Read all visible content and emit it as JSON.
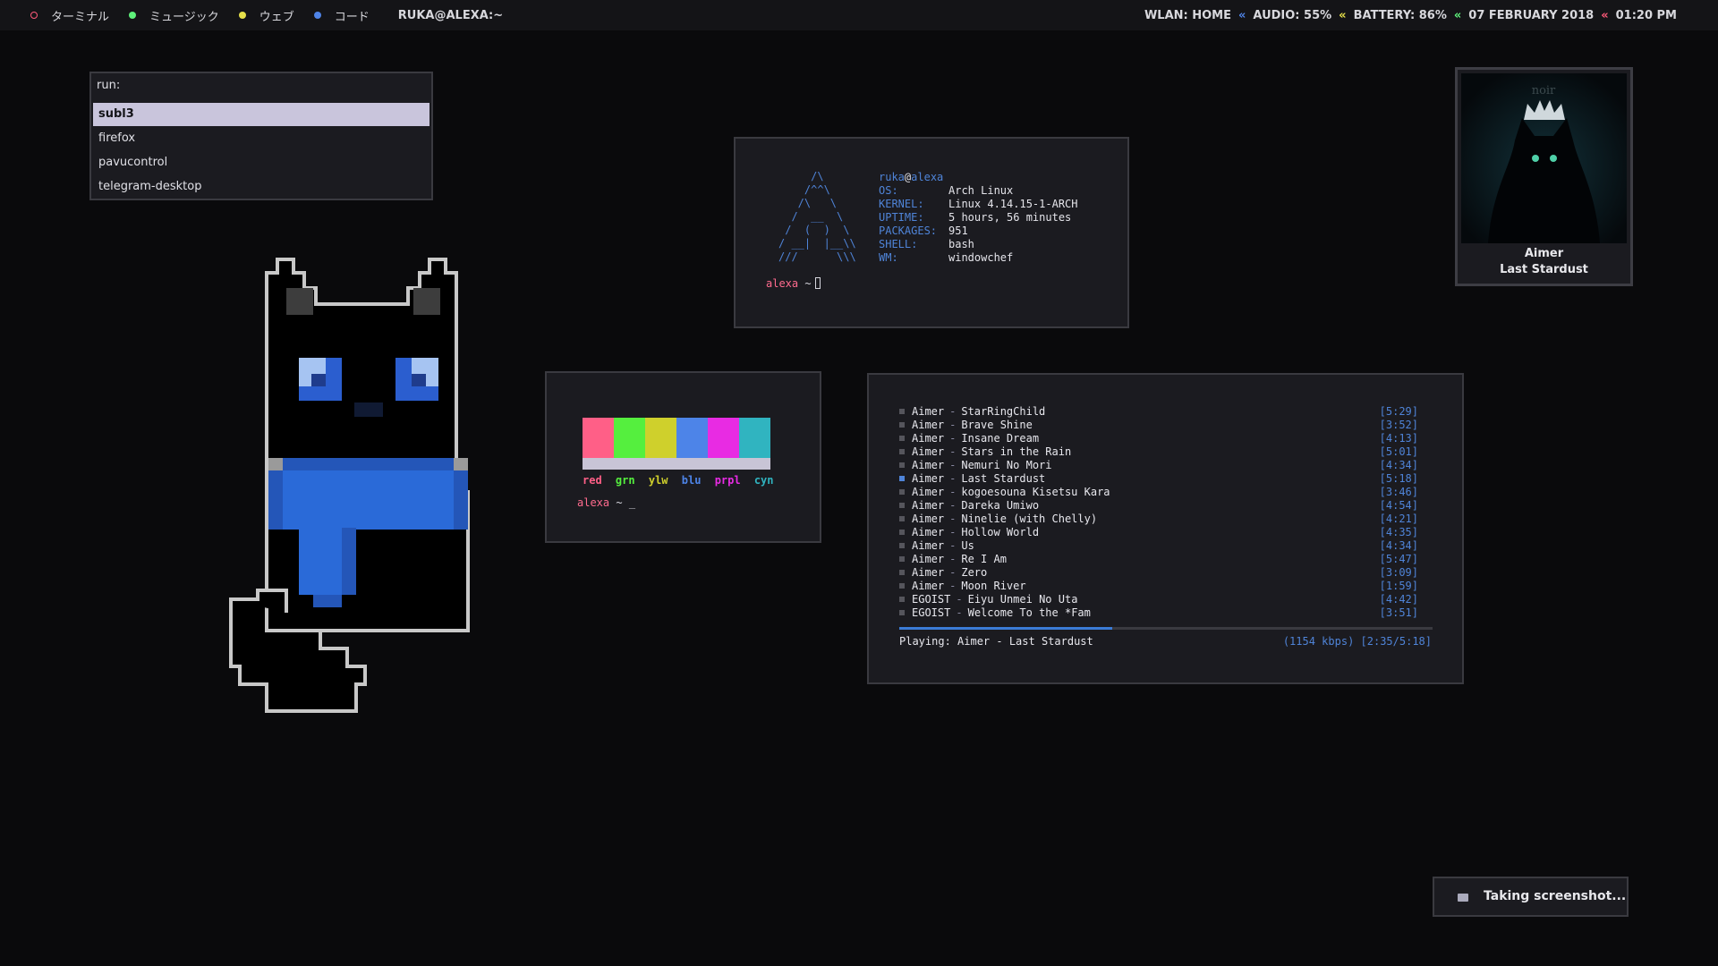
{
  "topbar": {
    "workspaces": [
      {
        "label": "ターミナル",
        "color": "#ff5a7a",
        "hollow": true
      },
      {
        "label": "ミュージック",
        "color": "#5ef07a",
        "hollow": false
      },
      {
        "label": "ウェブ",
        "color": "#e6e04a",
        "hollow": false
      },
      {
        "label": "コード",
        "color": "#4f84e8",
        "hollow": false
      }
    ],
    "window_title": "RUKA@ALEXA:~",
    "status": {
      "wlan": "WLAN: HOME",
      "audio": "AUDIO: 55%",
      "battery": "BATTERY: 86%",
      "date": "07 FEBRUARY 2018",
      "time": "01:20 PM",
      "separator": "«"
    }
  },
  "run_menu": {
    "prompt": "run:",
    "items": [
      "subl3",
      "firefox",
      "pavucontrol",
      "telegram-desktop"
    ],
    "selected_index": 0
  },
  "fetch": {
    "user": "ruka",
    "at": "@",
    "host": "alexa",
    "logo_lines": [
      "     /\\",
      "    /^^\\",
      "   /\\   \\",
      "  /  __  \\",
      " /  (  )  \\",
      "/ __|  |__\\\\",
      "///      \\\\\\"
    ],
    "info": [
      {
        "key": "OS:",
        "value": "Arch Linux"
      },
      {
        "key": "KERNEL:",
        "value": "Linux 4.14.15-1-ARCH"
      },
      {
        "key": "UPTIME:",
        "value": "5 hours, 56 minutes"
      },
      {
        "key": "PACKAGES:",
        "value": "951"
      },
      {
        "key": "SHELL:",
        "value": "bash"
      },
      {
        "key": "WM:",
        "value": "windowchef"
      }
    ],
    "prompt_host": "alexa",
    "prompt_symbol": "~"
  },
  "colors_term": {
    "swatches": [
      "#ff5f87",
      "#55ef3e",
      "#cfd02c",
      "#4d84e8",
      "#e82be3",
      "#30b4c0"
    ],
    "labels": [
      {
        "text": "red",
        "color": "#ff5f87"
      },
      {
        "text": "grn",
        "color": "#55ef3e"
      },
      {
        "text": "ylw",
        "color": "#cfd02c"
      },
      {
        "text": "blu",
        "color": "#4d84e8"
      },
      {
        "text": "prpl",
        "color": "#e82be3"
      },
      {
        "text": "cyn",
        "color": "#30b4c0"
      }
    ],
    "prompt_host": "alexa",
    "prompt_symbol": "~",
    "cursor": "_"
  },
  "album": {
    "art_text": "noir",
    "artist": "Aimer",
    "title": "Last Stardust"
  },
  "player": {
    "tracks": [
      {
        "artist": "Aimer",
        "song": "StarRingChild",
        "duration": "[5:29]"
      },
      {
        "artist": "Aimer",
        "song": "Brave Shine",
        "duration": "[3:52]"
      },
      {
        "artist": "Aimer",
        "song": "Insane Dream",
        "duration": "[4:13]"
      },
      {
        "artist": "Aimer",
        "song": "Stars in the Rain",
        "duration": "[5:01]"
      },
      {
        "artist": "Aimer",
        "song": "Nemuri No Mori",
        "duration": "[4:34]"
      },
      {
        "artist": "Aimer",
        "song": "Last Stardust",
        "duration": "[5:18]"
      },
      {
        "artist": "Aimer",
        "song": "kogoesouna Kisetsu Kara",
        "duration": "[3:46]"
      },
      {
        "artist": "Aimer",
        "song": "Dareka Umiwo",
        "duration": "[4:54]"
      },
      {
        "artist": "Aimer",
        "song": "Ninelie (with Chelly)",
        "duration": "[4:21]"
      },
      {
        "artist": "Aimer",
        "song": "Hollow World",
        "duration": "[4:35]"
      },
      {
        "artist": "Aimer",
        "song": "Us",
        "duration": "[4:34]"
      },
      {
        "artist": "Aimer",
        "song": "Re I Am",
        "duration": "[5:47]"
      },
      {
        "artist": "Aimer",
        "song": "Zero",
        "duration": "[3:09]"
      },
      {
        "artist": "Aimer",
        "song": "Moon River",
        "duration": "[1:59]"
      },
      {
        "artist": "EGOIST",
        "song": "Eiyu Unmei No Uta",
        "duration": "[4:42]"
      },
      {
        "artist": "EGOIST",
        "song": "Welcome To the *Fam",
        "duration": "[3:51]"
      }
    ],
    "active_index": 5,
    "progress_fraction": 0.4,
    "now_playing": "Playing: Aimer - Last Stardust",
    "bitrate_time": "(1154 kbps) [2:35/5:18]"
  },
  "notification": {
    "icon": "keyboard-icon",
    "text": "Taking screenshot..."
  }
}
